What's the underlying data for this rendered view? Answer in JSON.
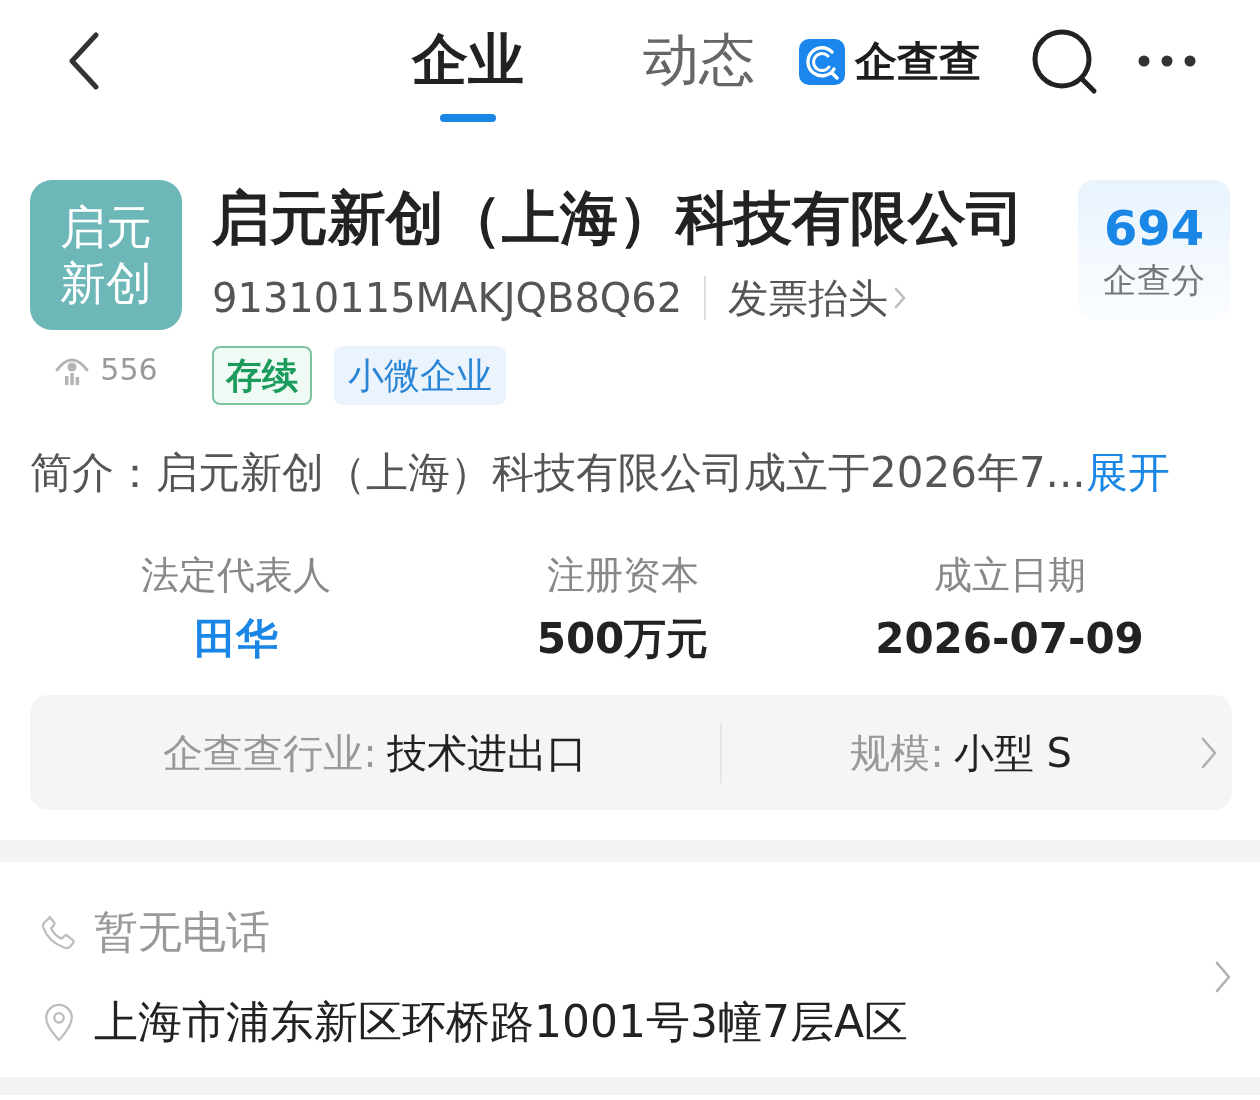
{
  "top_bar": {
    "tabs": [
      {
        "label": "企业",
        "selected": true
      },
      {
        "label": "动态",
        "selected": false
      }
    ],
    "brand": {
      "name": "企查查"
    }
  },
  "company": {
    "logo_text": "启元新创",
    "name": "启元新创（上海）科技有限公司",
    "views": "556",
    "credit_code": "91310115MAKJQB8Q62",
    "invoice_link": "发票抬头",
    "tags": [
      {
        "label": "存续",
        "kind": "status"
      },
      {
        "label": "小微企业",
        "kind": "scale"
      }
    ],
    "score": {
      "value": "694",
      "label": "企查分"
    }
  },
  "intro": {
    "text": "简介：启元新创（上海）科技有限公司成立于2026年7...",
    "action": "展开"
  },
  "key_facts": [
    {
      "label": "法定代表人",
      "value": "田华",
      "kind": "link"
    },
    {
      "label": "注册资本",
      "value": "500万元",
      "kind": "text"
    },
    {
      "label": "成立日期",
      "value": "2026-07-09",
      "kind": "text"
    }
  ],
  "industry": {
    "items": [
      {
        "label": "企查查行业:",
        "value": "技术进出口"
      },
      {
        "label": "规模:",
        "value": "小型 S"
      }
    ]
  },
  "contacts": [
    {
      "kind": "phone",
      "text": "暂无电话",
      "disabled": true
    },
    {
      "kind": "address",
      "text": "上海市浦东新区环桥路1001号3幢7层A区",
      "disabled": false
    }
  ]
}
